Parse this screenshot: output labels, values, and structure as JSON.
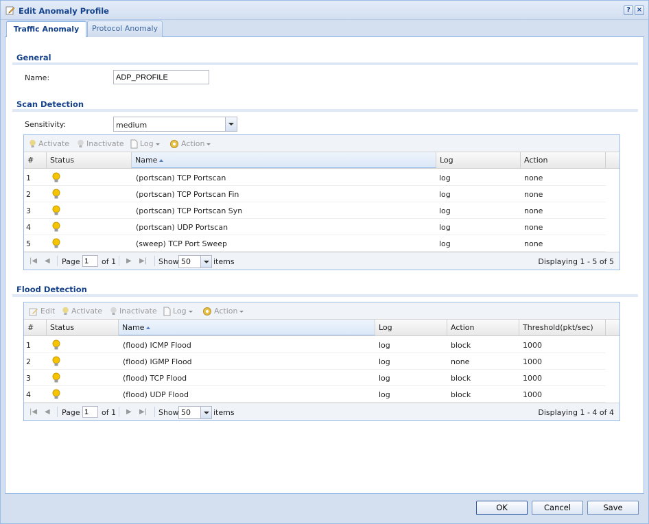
{
  "window": {
    "title": "Edit Anomaly Profile",
    "help_icon": "?",
    "close_icon": "×"
  },
  "tabs": [
    {
      "label": "Traffic Anomaly",
      "active": true
    },
    {
      "label": "Protocol Anomaly",
      "active": false
    }
  ],
  "general": {
    "title": "General",
    "name_label": "Name:",
    "name_value": "ADP_PROFILE"
  },
  "scan": {
    "title": "Scan Detection",
    "sensitivity_label": "Sensitivity:",
    "sensitivity_value": "medium",
    "toolbar": {
      "activate": "Activate",
      "inactivate": "Inactivate",
      "log": "Log",
      "action": "Action"
    },
    "columns": [
      "#",
      "Status",
      "Name",
      "Log",
      "Action"
    ],
    "rows": [
      {
        "num": "1",
        "name": "(portscan) TCP Portscan",
        "log": "log",
        "action": "none"
      },
      {
        "num": "2",
        "name": "(portscan) TCP Portscan Fin",
        "log": "log",
        "action": "none"
      },
      {
        "num": "3",
        "name": "(portscan) TCP Portscan Syn",
        "log": "log",
        "action": "none"
      },
      {
        "num": "4",
        "name": "(portscan) UDP Portscan",
        "log": "log",
        "action": "none"
      },
      {
        "num": "5",
        "name": "(sweep) TCP Port Sweep",
        "log": "log",
        "action": "none"
      }
    ],
    "pager": {
      "page_label": "Page",
      "page_value": "1",
      "of_label": "of 1",
      "show_label": "Show",
      "show_value": "50",
      "items_label": "items",
      "displaying": "Displaying 1 - 5 of 5"
    }
  },
  "flood": {
    "title": "Flood Detection",
    "toolbar": {
      "edit": "Edit",
      "activate": "Activate",
      "inactivate": "Inactivate",
      "log": "Log",
      "action": "Action"
    },
    "columns": [
      "#",
      "Status",
      "Name",
      "Log",
      "Action",
      "Threshold(pkt/sec)"
    ],
    "rows": [
      {
        "num": "1",
        "name": "(flood) ICMP Flood",
        "log": "log",
        "action": "block",
        "threshold": "1000"
      },
      {
        "num": "2",
        "name": "(flood) IGMP Flood",
        "log": "log",
        "action": "none",
        "threshold": "1000"
      },
      {
        "num": "3",
        "name": "(flood) TCP Flood",
        "log": "log",
        "action": "block",
        "threshold": "1000"
      },
      {
        "num": "4",
        "name": "(flood) UDP Flood",
        "log": "log",
        "action": "block",
        "threshold": "1000"
      }
    ],
    "pager": {
      "page_label": "Page",
      "page_value": "1",
      "of_label": "of 1",
      "show_label": "Show",
      "show_value": "50",
      "items_label": "items",
      "displaying": "Displaying 1 - 4 of 4"
    }
  },
  "buttons": {
    "ok": "OK",
    "cancel": "Cancel",
    "save": "Save"
  },
  "colors": {
    "title_text": "#15428b",
    "bulb_active": "#f5c400",
    "border": "#99bbe8"
  },
  "icons": {
    "title": "edit-pencil-icon",
    "status": "lightbulb-icon",
    "log": "document-icon",
    "action": "gear-icon"
  }
}
